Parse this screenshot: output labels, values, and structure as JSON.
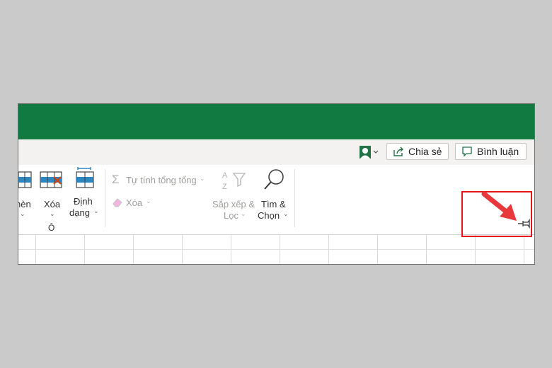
{
  "header": {
    "share_label": "Chia sẻ",
    "comments_label": "Bình luận"
  },
  "ribbon": {
    "partial_label": "hèn",
    "delete_label": "Xóa",
    "format_label_1": "Định",
    "format_label_2": "dạng",
    "group_cells_label": "Ô",
    "autosum_label": "Tự tính tổng tổng",
    "clear_label": "Xóa",
    "sort_label_1": "Sắp xếp &",
    "sort_label_2": "Lọc",
    "find_label_1": "Tìm &",
    "find_label_2": "Chọn"
  },
  "colors": {
    "title_bar": "#117a41",
    "highlight": "#e3151a",
    "accent": "#217346"
  },
  "icons": [
    "person-icon",
    "share-icon",
    "comment-icon",
    "insert-cells-icon",
    "delete-cells-icon",
    "format-cells-icon",
    "sigma-icon",
    "eraser-icon",
    "sort-filter-icon",
    "search-icon",
    "pin-icon",
    "red-arrow-icon"
  ]
}
